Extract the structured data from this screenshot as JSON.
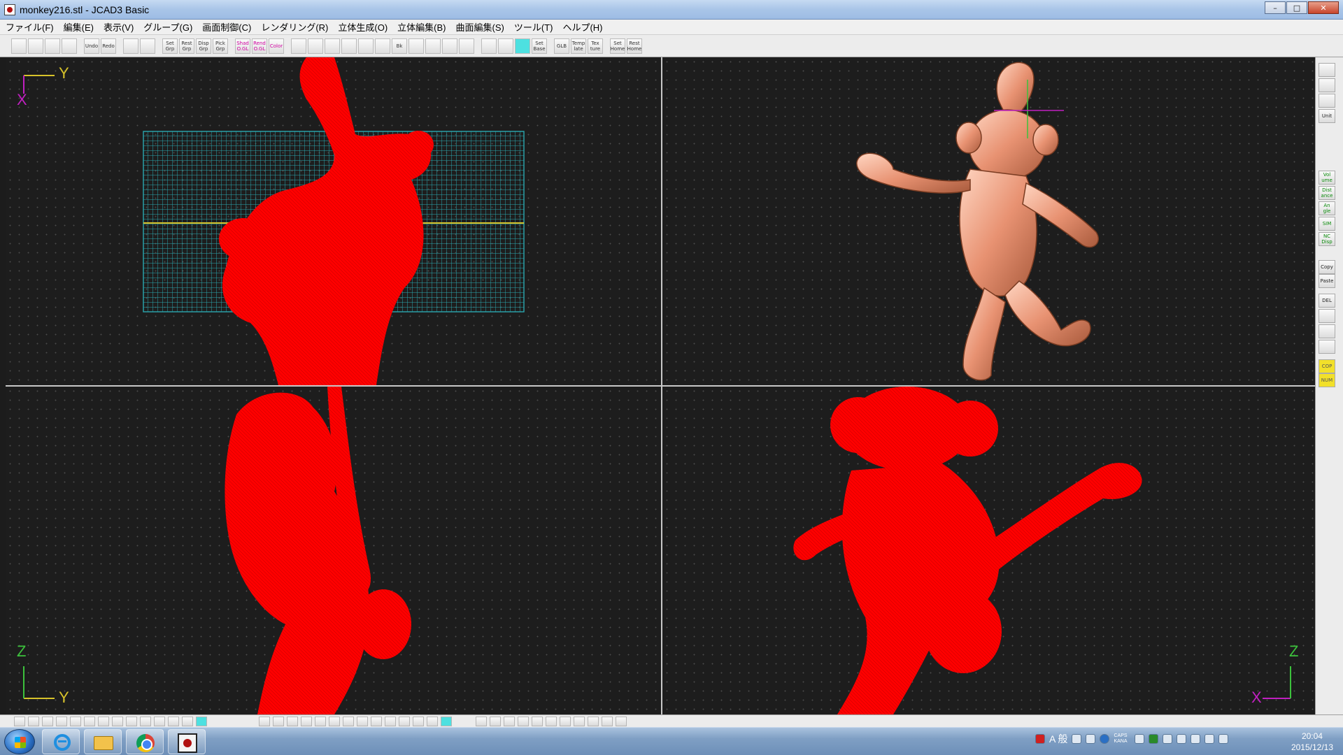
{
  "window": {
    "title": "monkey216.stl - JCAD3 Basic",
    "controls": {
      "minimize": "–",
      "maximize": "□",
      "close": "✕"
    }
  },
  "menu": [
    "ファイル(F)",
    "編集(E)",
    "表示(V)",
    "グループ(G)",
    "画面制御(C)",
    "レンダリング(R)",
    "立体生成(O)",
    "立体編集(B)",
    "曲面編集(S)",
    "ツール(T)",
    "ヘルプ(H)"
  ],
  "toolbar": {
    "groups": [
      [
        {
          "icon": "new-file-icon",
          "label": ""
        },
        {
          "icon": "open-folder-icon",
          "label": ""
        },
        {
          "icon": "save-icon",
          "label": ""
        },
        {
          "icon": "print-icon",
          "label": ""
        }
      ],
      [
        {
          "icon": "undo-icon",
          "label": "Undo"
        },
        {
          "icon": "redo-icon",
          "label": "Redo"
        }
      ],
      [
        {
          "icon": "grid-a-icon",
          "label": ""
        },
        {
          "icon": "grid-b-icon",
          "label": ""
        }
      ],
      [
        {
          "icon": "set-grp-icon",
          "label": "Set Grp"
        },
        {
          "icon": "rest-grp-icon",
          "label": "Rest Grp"
        },
        {
          "icon": "disp-grp-icon",
          "label": "Disp Grp"
        },
        {
          "icon": "pick-grp-icon",
          "label": "Pick Grp"
        }
      ],
      [
        {
          "icon": "shad-ogl-icon",
          "label": "Shad O.GL",
          "accent": "pink"
        },
        {
          "icon": "rend-ogl-icon",
          "label": "Rend O.GL",
          "accent": "pink"
        },
        {
          "icon": "color-icon",
          "label": "Color",
          "accent": "pink"
        }
      ],
      [
        {
          "icon": "zoom-in-icon",
          "label": ""
        },
        {
          "icon": "zoom-out-icon",
          "label": ""
        },
        {
          "icon": "zoom-fit-icon",
          "label": ""
        },
        {
          "icon": "zoom-window-icon",
          "label": ""
        },
        {
          "icon": "zoom-all-icon",
          "label": ""
        },
        {
          "icon": "pan-hand-icon",
          "label": ""
        },
        {
          "icon": "back-view-icon",
          "label": "Bk"
        },
        {
          "icon": "zoom-red-a-icon",
          "label": ""
        },
        {
          "icon": "zoom-red-b-icon",
          "label": ""
        },
        {
          "icon": "zoom-red-c-icon",
          "label": ""
        },
        {
          "icon": "frame-icon",
          "label": ""
        }
      ],
      [
        {
          "icon": "grid-dots-icon",
          "label": ""
        },
        {
          "icon": "grid-snap-icon",
          "label": ""
        },
        {
          "icon": "grid-active-icon",
          "label": "",
          "accent": "cyan"
        },
        {
          "icon": "set-base-icon",
          "label": "Set Base"
        }
      ],
      [
        {
          "icon": "glb-icon",
          "label": "GLB"
        },
        {
          "icon": "template-icon",
          "label": "Temp late"
        },
        {
          "icon": "texture-icon",
          "label": "Tex ture"
        }
      ],
      [
        {
          "icon": "set-home-icon",
          "label": "Set Home"
        },
        {
          "icon": "rest-home-icon",
          "label": "Rest Home"
        }
      ]
    ]
  },
  "viewports": {
    "top_left": {
      "axis_labels": [
        "Y",
        "X"
      ]
    },
    "bottom_left": {
      "axis_labels": [
        "Z",
        "Y"
      ]
    },
    "bottom_right": {
      "axis_labels": [
        "Z",
        "X"
      ]
    },
    "top_right": {
      "axis_labels": []
    }
  },
  "right_panel": [
    {
      "icon": "eye-camera-icon",
      "label": ""
    },
    {
      "icon": "printer-3d-icon",
      "label": ""
    },
    {
      "icon": "diamond-icon",
      "label": ""
    },
    {
      "icon": "unit-icon",
      "label": "Unit"
    },
    {
      "icon": "volume-icon",
      "label": "Vol ume",
      "accent": "green"
    },
    {
      "icon": "distance-icon",
      "label": "Dist ance",
      "accent": "green"
    },
    {
      "icon": "angle-icon",
      "label": "An gle",
      "accent": "green"
    },
    {
      "icon": "sim-icon",
      "label": "SIM",
      "accent": "green"
    },
    {
      "icon": "nc-disp-icon",
      "label": "NC Disp",
      "accent": "green"
    },
    {
      "icon": "copy-icon",
      "label": "Copy"
    },
    {
      "icon": "paste-icon",
      "label": "Paste"
    },
    {
      "icon": "delete-icon",
      "label": "DEL"
    },
    {
      "icon": "tool-a-icon",
      "label": ""
    },
    {
      "icon": "tool-b-icon",
      "label": ""
    },
    {
      "icon": "tree-icon",
      "label": ""
    },
    {
      "icon": "cop-icon",
      "label": "COP",
      "accent": "yellow"
    },
    {
      "icon": "num-icon",
      "label": "NUM",
      "accent": "yellow"
    }
  ],
  "taskbar": {
    "apps": [
      "internet-explorer-icon",
      "explorer-folder-icon",
      "chrome-icon",
      "jcad-app-icon"
    ],
    "ime_mode": "A 般",
    "caps_indicator": "CAPS KANA",
    "time": "20:04",
    "date": "2015/12/13"
  },
  "colors": {
    "wire_red": "#ff0000",
    "grid_cyan": "#2aa8b0",
    "axis_yellow": "#d7c22a",
    "axis_magenta": "#c020c0",
    "axis_green": "#3cc23c",
    "shaded_copper": "#e89272"
  }
}
